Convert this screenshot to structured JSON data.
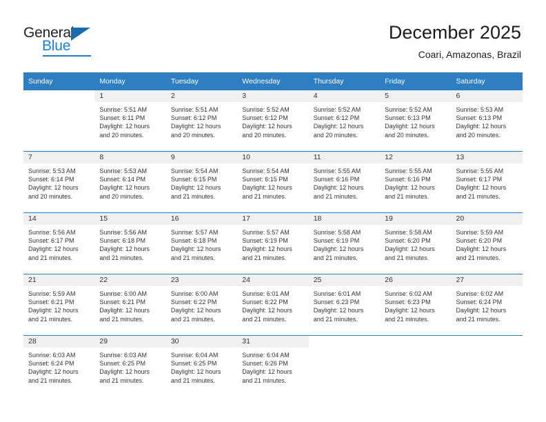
{
  "brand": {
    "name_part1": "General",
    "name_part2": "Blue",
    "logo_icon": "triangle-flag-icon",
    "accent_color": "#1a7fd4",
    "header_color": "#2f7ec1"
  },
  "header": {
    "title": "December 2025",
    "subtitle": "Coari, Amazonas, Brazil"
  },
  "calendar": {
    "weekday_headers": [
      "Sunday",
      "Monday",
      "Tuesday",
      "Wednesday",
      "Thursday",
      "Friday",
      "Saturday"
    ],
    "weeks": [
      [
        {
          "day": "",
          "sunrise": "",
          "sunset": "",
          "daylight_line1": "",
          "daylight_line2": ""
        },
        {
          "day": "1",
          "sunrise": "Sunrise: 5:51 AM",
          "sunset": "Sunset: 6:11 PM",
          "daylight_line1": "Daylight: 12 hours",
          "daylight_line2": "and 20 minutes."
        },
        {
          "day": "2",
          "sunrise": "Sunrise: 5:51 AM",
          "sunset": "Sunset: 6:12 PM",
          "daylight_line1": "Daylight: 12 hours",
          "daylight_line2": "and 20 minutes."
        },
        {
          "day": "3",
          "sunrise": "Sunrise: 5:52 AM",
          "sunset": "Sunset: 6:12 PM",
          "daylight_line1": "Daylight: 12 hours",
          "daylight_line2": "and 20 minutes."
        },
        {
          "day": "4",
          "sunrise": "Sunrise: 5:52 AM",
          "sunset": "Sunset: 6:12 PM",
          "daylight_line1": "Daylight: 12 hours",
          "daylight_line2": "and 20 minutes."
        },
        {
          "day": "5",
          "sunrise": "Sunrise: 5:52 AM",
          "sunset": "Sunset: 6:13 PM",
          "daylight_line1": "Daylight: 12 hours",
          "daylight_line2": "and 20 minutes."
        },
        {
          "day": "6",
          "sunrise": "Sunrise: 5:53 AM",
          "sunset": "Sunset: 6:13 PM",
          "daylight_line1": "Daylight: 12 hours",
          "daylight_line2": "and 20 minutes."
        }
      ],
      [
        {
          "day": "7",
          "sunrise": "Sunrise: 5:53 AM",
          "sunset": "Sunset: 6:14 PM",
          "daylight_line1": "Daylight: 12 hours",
          "daylight_line2": "and 20 minutes."
        },
        {
          "day": "8",
          "sunrise": "Sunrise: 5:53 AM",
          "sunset": "Sunset: 6:14 PM",
          "daylight_line1": "Daylight: 12 hours",
          "daylight_line2": "and 20 minutes."
        },
        {
          "day": "9",
          "sunrise": "Sunrise: 5:54 AM",
          "sunset": "Sunset: 6:15 PM",
          "daylight_line1": "Daylight: 12 hours",
          "daylight_line2": "and 21 minutes."
        },
        {
          "day": "10",
          "sunrise": "Sunrise: 5:54 AM",
          "sunset": "Sunset: 6:15 PM",
          "daylight_line1": "Daylight: 12 hours",
          "daylight_line2": "and 21 minutes."
        },
        {
          "day": "11",
          "sunrise": "Sunrise: 5:55 AM",
          "sunset": "Sunset: 6:16 PM",
          "daylight_line1": "Daylight: 12 hours",
          "daylight_line2": "and 21 minutes."
        },
        {
          "day": "12",
          "sunrise": "Sunrise: 5:55 AM",
          "sunset": "Sunset: 6:16 PM",
          "daylight_line1": "Daylight: 12 hours",
          "daylight_line2": "and 21 minutes."
        },
        {
          "day": "13",
          "sunrise": "Sunrise: 5:55 AM",
          "sunset": "Sunset: 6:17 PM",
          "daylight_line1": "Daylight: 12 hours",
          "daylight_line2": "and 21 minutes."
        }
      ],
      [
        {
          "day": "14",
          "sunrise": "Sunrise: 5:56 AM",
          "sunset": "Sunset: 6:17 PM",
          "daylight_line1": "Daylight: 12 hours",
          "daylight_line2": "and 21 minutes."
        },
        {
          "day": "15",
          "sunrise": "Sunrise: 5:56 AM",
          "sunset": "Sunset: 6:18 PM",
          "daylight_line1": "Daylight: 12 hours",
          "daylight_line2": "and 21 minutes."
        },
        {
          "day": "16",
          "sunrise": "Sunrise: 5:57 AM",
          "sunset": "Sunset: 6:18 PM",
          "daylight_line1": "Daylight: 12 hours",
          "daylight_line2": "and 21 minutes."
        },
        {
          "day": "17",
          "sunrise": "Sunrise: 5:57 AM",
          "sunset": "Sunset: 6:19 PM",
          "daylight_line1": "Daylight: 12 hours",
          "daylight_line2": "and 21 minutes."
        },
        {
          "day": "18",
          "sunrise": "Sunrise: 5:58 AM",
          "sunset": "Sunset: 6:19 PM",
          "daylight_line1": "Daylight: 12 hours",
          "daylight_line2": "and 21 minutes."
        },
        {
          "day": "19",
          "sunrise": "Sunrise: 5:58 AM",
          "sunset": "Sunset: 6:20 PM",
          "daylight_line1": "Daylight: 12 hours",
          "daylight_line2": "and 21 minutes."
        },
        {
          "day": "20",
          "sunrise": "Sunrise: 5:59 AM",
          "sunset": "Sunset: 6:20 PM",
          "daylight_line1": "Daylight: 12 hours",
          "daylight_line2": "and 21 minutes."
        }
      ],
      [
        {
          "day": "21",
          "sunrise": "Sunrise: 5:59 AM",
          "sunset": "Sunset: 6:21 PM",
          "daylight_line1": "Daylight: 12 hours",
          "daylight_line2": "and 21 minutes."
        },
        {
          "day": "22",
          "sunrise": "Sunrise: 6:00 AM",
          "sunset": "Sunset: 6:21 PM",
          "daylight_line1": "Daylight: 12 hours",
          "daylight_line2": "and 21 minutes."
        },
        {
          "day": "23",
          "sunrise": "Sunrise: 6:00 AM",
          "sunset": "Sunset: 6:22 PM",
          "daylight_line1": "Daylight: 12 hours",
          "daylight_line2": "and 21 minutes."
        },
        {
          "day": "24",
          "sunrise": "Sunrise: 6:01 AM",
          "sunset": "Sunset: 6:22 PM",
          "daylight_line1": "Daylight: 12 hours",
          "daylight_line2": "and 21 minutes."
        },
        {
          "day": "25",
          "sunrise": "Sunrise: 6:01 AM",
          "sunset": "Sunset: 6:23 PM",
          "daylight_line1": "Daylight: 12 hours",
          "daylight_line2": "and 21 minutes."
        },
        {
          "day": "26",
          "sunrise": "Sunrise: 6:02 AM",
          "sunset": "Sunset: 6:23 PM",
          "daylight_line1": "Daylight: 12 hours",
          "daylight_line2": "and 21 minutes."
        },
        {
          "day": "27",
          "sunrise": "Sunrise: 6:02 AM",
          "sunset": "Sunset: 6:24 PM",
          "daylight_line1": "Daylight: 12 hours",
          "daylight_line2": "and 21 minutes."
        }
      ],
      [
        {
          "day": "28",
          "sunrise": "Sunrise: 6:03 AM",
          "sunset": "Sunset: 6:24 PM",
          "daylight_line1": "Daylight: 12 hours",
          "daylight_line2": "and 21 minutes."
        },
        {
          "day": "29",
          "sunrise": "Sunrise: 6:03 AM",
          "sunset": "Sunset: 6:25 PM",
          "daylight_line1": "Daylight: 12 hours",
          "daylight_line2": "and 21 minutes."
        },
        {
          "day": "30",
          "sunrise": "Sunrise: 6:04 AM",
          "sunset": "Sunset: 6:25 PM",
          "daylight_line1": "Daylight: 12 hours",
          "daylight_line2": "and 21 minutes."
        },
        {
          "day": "31",
          "sunrise": "Sunrise: 6:04 AM",
          "sunset": "Sunset: 6:26 PM",
          "daylight_line1": "Daylight: 12 hours",
          "daylight_line2": "and 21 minutes."
        },
        {
          "day": "",
          "sunrise": "",
          "sunset": "",
          "daylight_line1": "",
          "daylight_line2": ""
        },
        {
          "day": "",
          "sunrise": "",
          "sunset": "",
          "daylight_line1": "",
          "daylight_line2": ""
        },
        {
          "day": "",
          "sunrise": "",
          "sunset": "",
          "daylight_line1": "",
          "daylight_line2": ""
        }
      ]
    ]
  }
}
